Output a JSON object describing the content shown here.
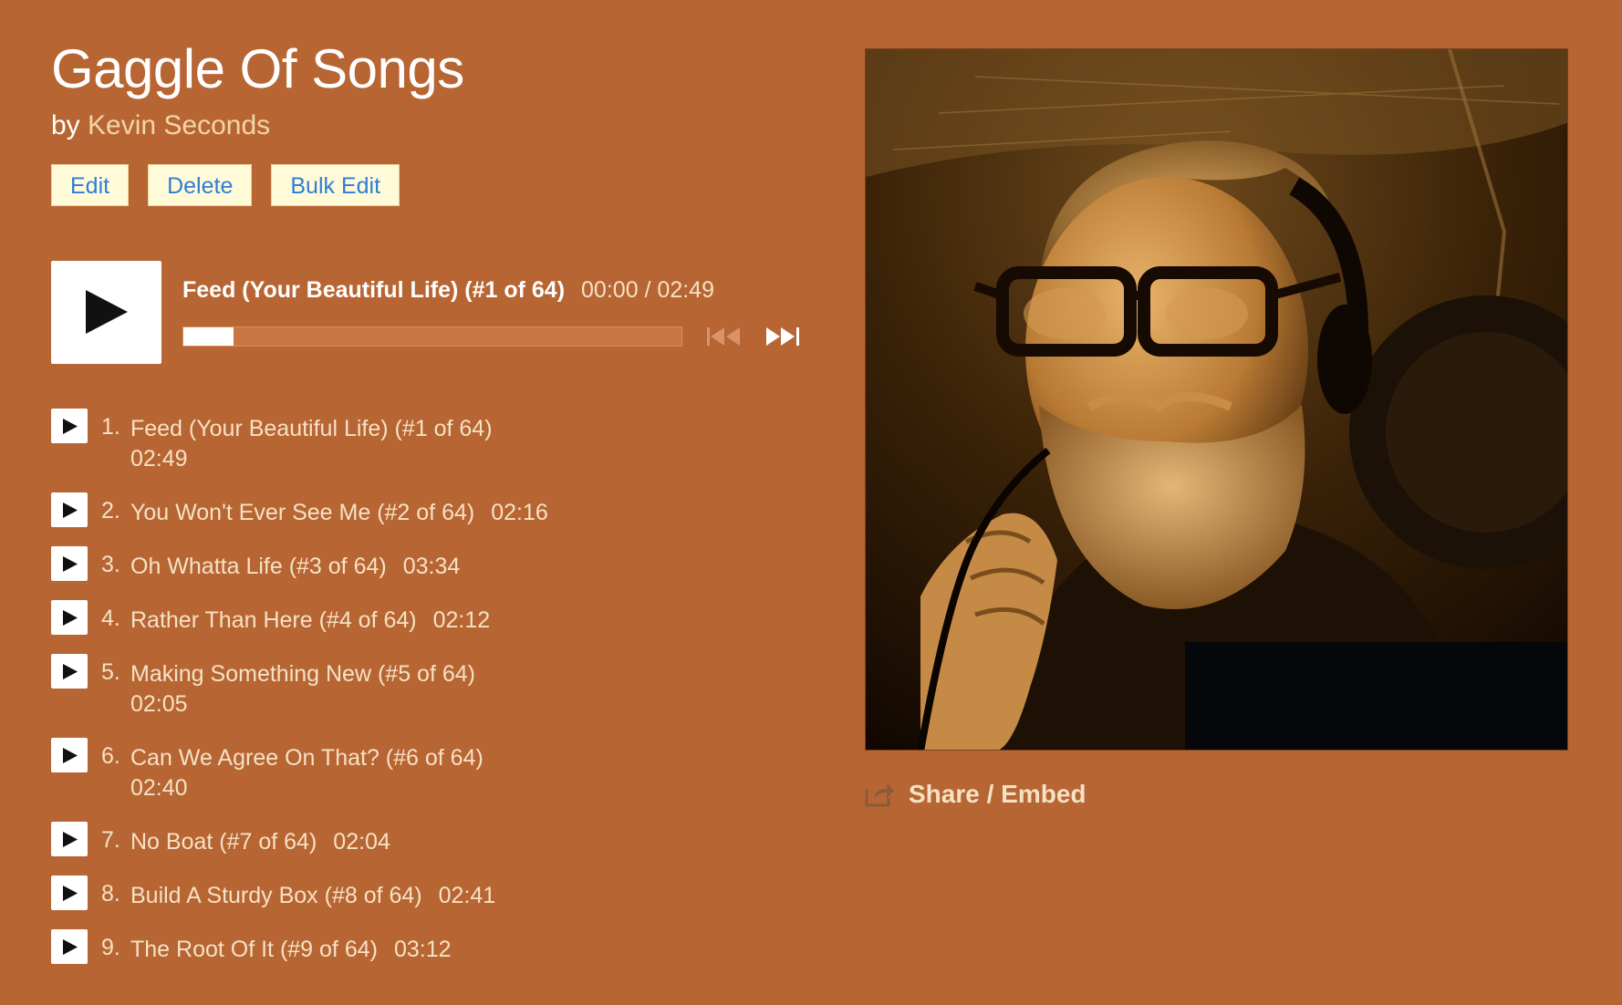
{
  "album": {
    "title": "Gaggle Of Songs",
    "by_prefix": "by",
    "artist": "Kevin Seconds"
  },
  "admin_buttons": {
    "edit": "Edit",
    "delete": "Delete",
    "bulk_edit": "Bulk Edit"
  },
  "player": {
    "now_playing_title": "Feed (Your Beautiful Life) (#1 of 64)",
    "time": "00:00 / 02:49",
    "progress_fraction": 0.1,
    "play_icon": "play-icon",
    "prev_icon": "previous-track-icon",
    "next_icon": "next-track-icon"
  },
  "tracks": [
    {
      "num": "1.",
      "title": "Feed (Your Beautiful Life) (#1 of 64)",
      "duration": "02:49",
      "wrapped": true
    },
    {
      "num": "2.",
      "title": "You Won't Ever See Me (#2 of 64)",
      "duration": "02:16",
      "wrapped": false
    },
    {
      "num": "3.",
      "title": "Oh Whatta Life (#3 of 64)",
      "duration": "03:34",
      "wrapped": false
    },
    {
      "num": "4.",
      "title": "Rather Than Here (#4 of 64)",
      "duration": "02:12",
      "wrapped": false
    },
    {
      "num": "5.",
      "title": "Making Something New (#5 of 64)",
      "duration": "02:05",
      "wrapped": true
    },
    {
      "num": "6.",
      "title": "Can We Agree On That? (#6 of 64)",
      "duration": "02:40",
      "wrapped": true
    },
    {
      "num": "7.",
      "title": "No Boat (#7 of 64)",
      "duration": "02:04",
      "wrapped": false
    },
    {
      "num": "8.",
      "title": "Build A Sturdy Box (#8 of 64)",
      "duration": "02:41",
      "wrapped": false
    },
    {
      "num": "9.",
      "title": "The Root Of It (#9 of 64)",
      "duration": "03:12",
      "wrapped": false
    }
  ],
  "share": {
    "label": "Share / Embed",
    "icon": "share-icon"
  },
  "colors": {
    "background": "#b86534",
    "link": "#f5e2c4",
    "button_bg": "#fffbd9",
    "button_text": "#2f7dd6"
  }
}
